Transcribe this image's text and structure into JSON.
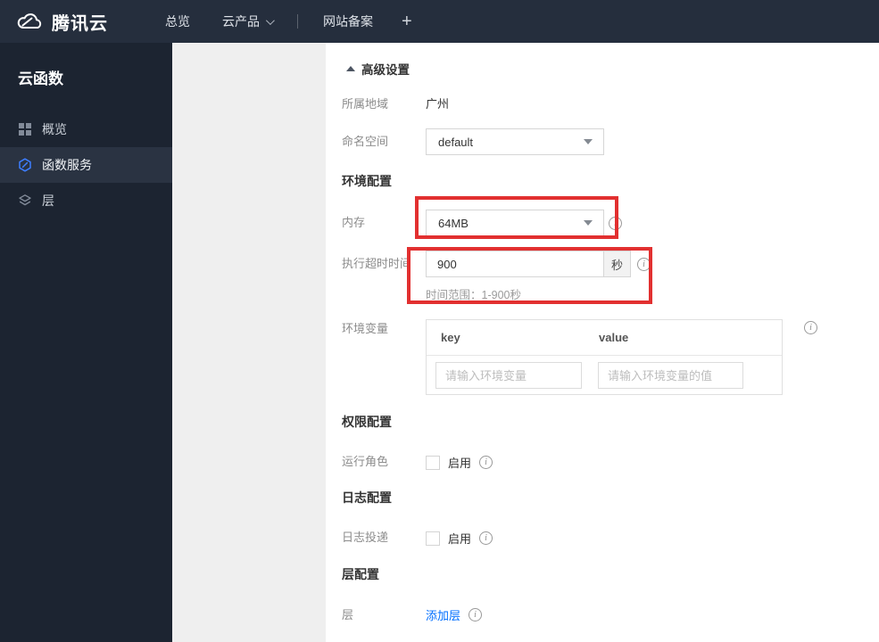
{
  "colors": {
    "topbar_bg": "#252e3d",
    "sidebar_bg": "#1c2431",
    "sidebar_active_bg": "#2a3342",
    "accent_blue": "#006eff",
    "scf_icon_blue": "#3d7eff",
    "annotation_red": "#e23030",
    "left_panel_gray": "#efefef"
  },
  "icons": {
    "logo": "cloud-logo",
    "nav_caret": "chevron-down",
    "overview": "grid-icon",
    "function_service": "hexagon-scf-icon",
    "layer": "layers-icon",
    "dropdown_caret": "caret-down",
    "info": "info-circle",
    "collapse": "triangle-up"
  },
  "topbar": {
    "brand": "腾讯云",
    "nav": [
      {
        "label": "总览"
      },
      {
        "label": "云产品",
        "has_caret": true
      },
      {
        "label": "网站备案"
      },
      {
        "label": "+"
      }
    ]
  },
  "sidebar": {
    "title": "云函数",
    "items": [
      {
        "label": "概览",
        "active": false
      },
      {
        "label": "函数服务",
        "active": true
      },
      {
        "label": "层",
        "active": false
      }
    ]
  },
  "main": {
    "advanced_settings_toggle": "高级设置",
    "region": {
      "label": "所属地域",
      "value": "广州"
    },
    "namespace": {
      "label": "命名空间",
      "value": "default"
    },
    "sections": {
      "environment": "环境配置",
      "permission": "权限配置",
      "log": "日志配置",
      "layer": "层配置"
    },
    "memory": {
      "label": "内存",
      "value": "64MB"
    },
    "timeout": {
      "label": "执行超时时间",
      "value": "900",
      "unit": "秒",
      "hint": "时间范围：1-900秒"
    },
    "env_vars": {
      "label": "环境变量",
      "columns": [
        "key",
        "value"
      ],
      "key_placeholder": "请输入环境变量",
      "value_placeholder": "请输入环境变量的值"
    },
    "run_role": {
      "label": "运行角色",
      "enable_label": "启用"
    },
    "log_delivery": {
      "label": "日志投递",
      "enable_label": "启用"
    },
    "layer": {
      "label": "层",
      "add_link": "添加层"
    }
  }
}
